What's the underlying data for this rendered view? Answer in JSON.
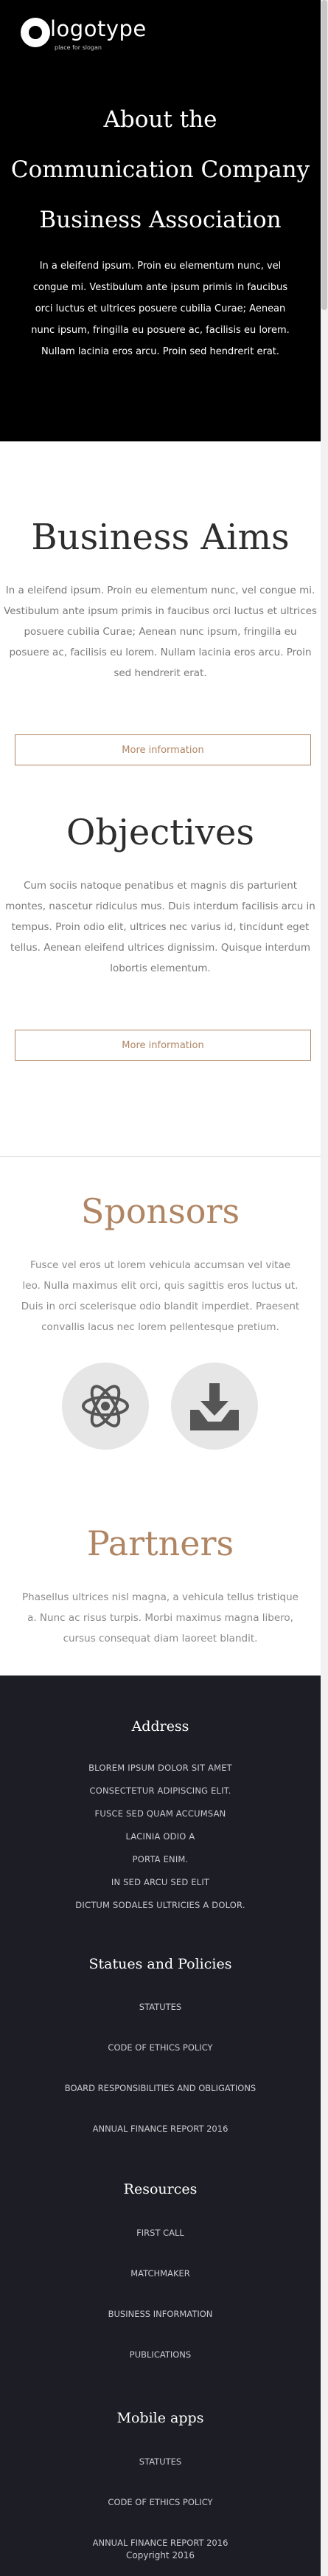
{
  "logo": {
    "name": "logotype",
    "tagline": "place for slogan"
  },
  "hero": {
    "title_lines": [
      "About the",
      "Communication Company",
      "Business Association"
    ],
    "text": "In a eleifend ipsum. Proin eu elementum nunc, vel congue mi. Vestibulum ante ipsum primis in faucibus orci luctus et ultrices posuere cubilia Curae; Aenean nunc ipsum, fringilla eu posuere ac, facilisis eu lorem. Nullam lacinia eros arcu. Proin sed hendrerit erat."
  },
  "aims": {
    "title": "Business Aims",
    "text": "In a eleifend ipsum. Proin eu elementum nunc, vel congue mi. Vestibulum ante ipsum primis in faucibus orci luctus et ultrices posuere cubilia Curae; Aenean nunc ipsum, fringilla eu posuere ac, facilisis eu lorem. Nullam lacinia eros arcu. Proin sed hendrerit erat.",
    "button": "More information"
  },
  "objectives": {
    "title": "Objectives",
    "text": "Cum sociis natoque penatibus et magnis dis parturient montes, nascetur ridiculus mus. Duis interdum facilisis arcu in tempus. Proin odio elit, ultrices nec varius id, tincidunt eget tellus. Aenean eleifend ultrices dignissim. Quisque interdum lobortis elementum.",
    "button": "More information"
  },
  "sponsors": {
    "title": "Sponsors",
    "text": "Fusce vel eros ut lorem vehicula accumsan vel vitae leo. Nulla maximus elit orci, quis sagittis eros luctus ut. Duis in orci scelerisque odio blandit imperdiet. Praesent convallis lacus nec lorem pellentesque pretium.",
    "icons": [
      "atom-icon",
      "download-tray-icon"
    ]
  },
  "partners": {
    "title": "Partners",
    "text": "Phasellus ultrices nisl magna, a vehicula tellus tristique a. Nunc ac risus turpis. Morbi maximus magna libero, cursus consequat diam laoreet blandit."
  },
  "footer": {
    "address": {
      "title": "Address",
      "lines": [
        "BLOREM IPSUM DOLOR SIT AMET",
        "CONSECTETUR ADIPISCING ELIT.",
        "FUSCE SED QUAM ACCUMSAN",
        "LACINIA ODIO A",
        "PORTA ENIM.",
        "IN SED ARCU SED ELIT",
        "DICTUM SODALES ULTRICIES A DOLOR."
      ]
    },
    "statutes": {
      "title": "Statues and Policies",
      "links": [
        "STATUTES",
        "CODE OF ETHICS POLICY",
        "BOARD RESPONSIBILITIES AND OBLIGATIONS",
        "ANNUAL FINANCE REPORT 2016"
      ]
    },
    "resources": {
      "title": "Resources",
      "links": [
        "FIRST CALL",
        "MATCHMAKER",
        "BUSINESS INFORMATION",
        "PUBLICATIONS"
      ]
    },
    "mobile": {
      "title": "Mobile apps",
      "links": [
        "STATUTES",
        "CODE OF ETHICS POLICY",
        "ANNUAL FINANCE REPORT 2016"
      ]
    },
    "copyright": "Copyright 2016"
  },
  "colors": {
    "accent": "#b08563",
    "footer_bg": "#1d1d25",
    "hero_bg": "#000000"
  }
}
